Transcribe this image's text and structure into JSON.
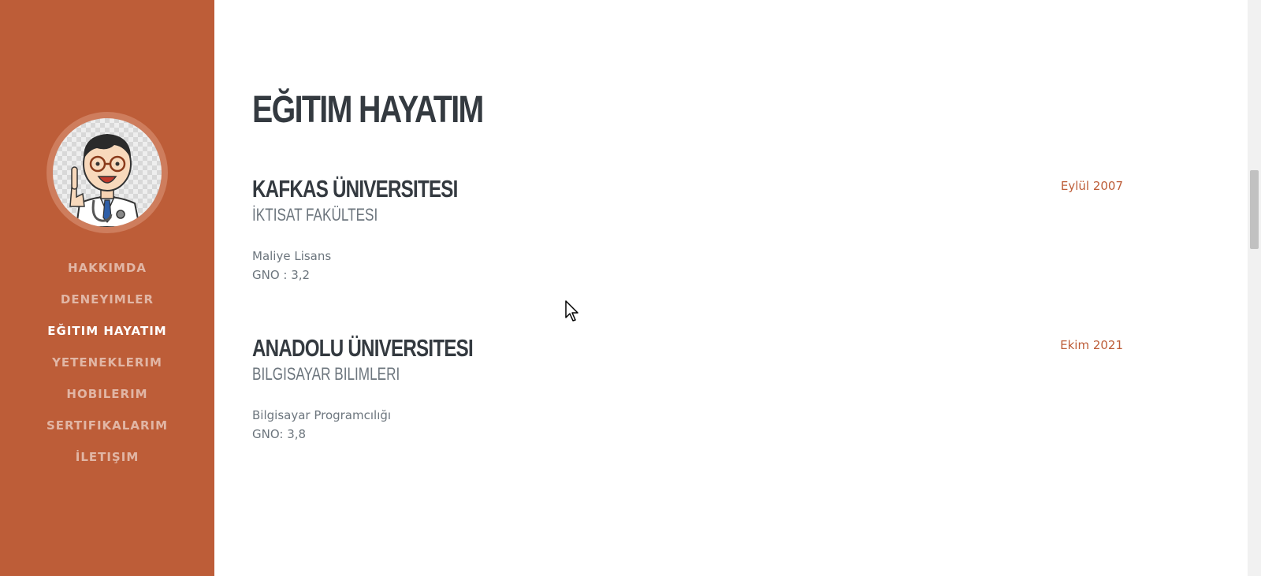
{
  "sidebar": {
    "avatar_alt": "profile-avatar",
    "items": [
      {
        "label": "HAKKIMDA"
      },
      {
        "label": "DENEYIMLER"
      },
      {
        "label": "EĞITIM HAYATIM"
      },
      {
        "label": "YETENEKLERIM"
      },
      {
        "label": "HOBILERIM"
      },
      {
        "label": "SERTIFIKALARIM"
      },
      {
        "label": "İLETIŞIM"
      }
    ],
    "active_item": "EĞITIM HAYATIM"
  },
  "main": {
    "title": "EĞITIM HAYATIM",
    "entries": [
      {
        "school": "KAFKAS ÜNIVERSITESI",
        "faculty": "İKTISAT FAKÜLTESI",
        "program": "Maliye Lisans",
        "gpa": "GNO : 3,2",
        "date": "Eylül 2007"
      },
      {
        "school": "ANADOLU ÜNIVERSITESI",
        "faculty": "BILGISAYAR BILIMLERI",
        "program": "Bilgisayar Programcılığı",
        "gpa": "GNO: 3,8",
        "date": "Ekim 2021"
      }
    ]
  },
  "colors": {
    "sidebar_bg": "#bd5d38",
    "heading": "#343a40",
    "muted_text": "#6c757d",
    "accent_date": "#bd5d38"
  }
}
